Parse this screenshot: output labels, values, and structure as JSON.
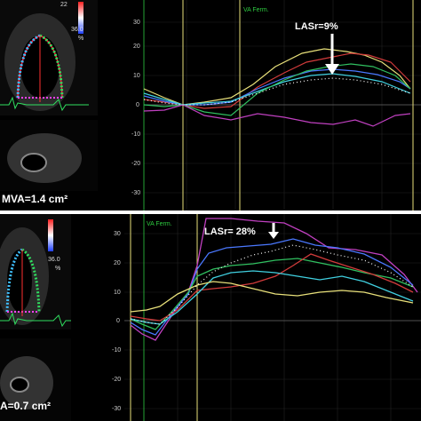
{
  "top": {
    "mva_label": "MVA=1.4 cm²",
    "lasr_label": "LASr=9%",
    "va_label": "VA Ferm.",
    "scale_value": "36.0",
    "scale_unit": "%",
    "scale_top_partial": "22",
    "y_ticks": [
      "30",
      "20",
      "10",
      "0",
      "-10",
      "-20",
      "-30"
    ]
  },
  "bottom": {
    "mva_label": "A=0.7 cm²",
    "lasr_label": "LASr= 28%",
    "va_label": "VA Ferm.",
    "scale_value": "36.0",
    "scale_unit": "%",
    "y_ticks": [
      "30",
      "20",
      "10",
      "0",
      "-10",
      "-20",
      "-30"
    ]
  },
  "colors": {
    "strain_pos": "#d23b3b",
    "strain_neg": "#3b5bd2",
    "marker_yellow": "#e8e07a",
    "va_green": "#2ecc40",
    "grid": "#2a2a2a"
  }
}
